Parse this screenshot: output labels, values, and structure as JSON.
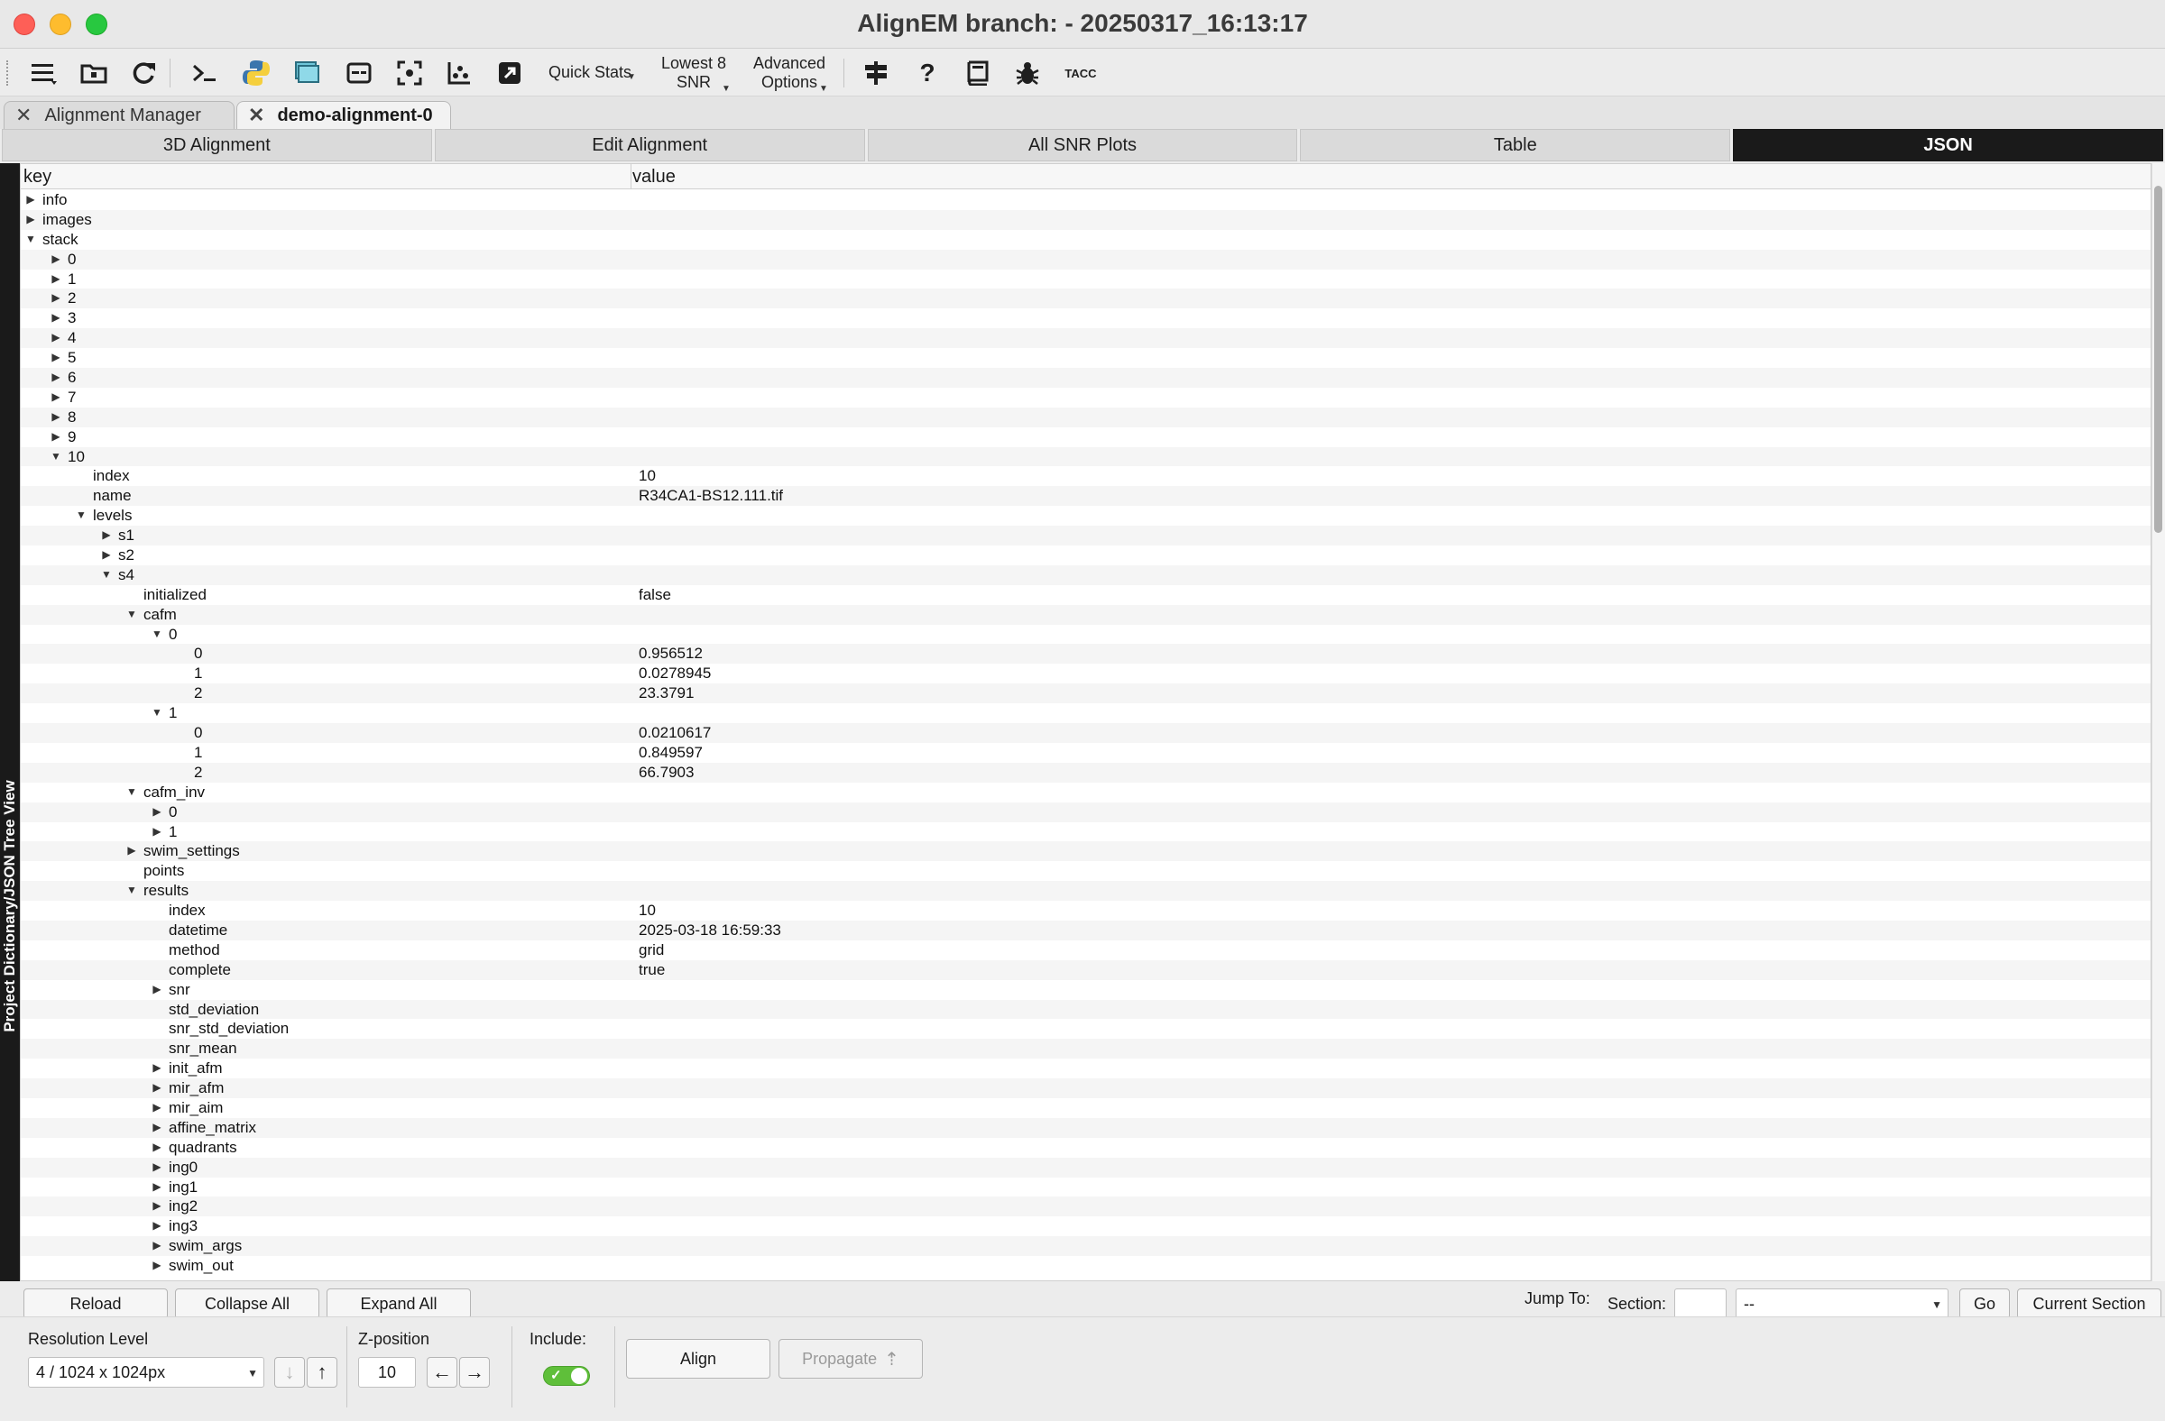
{
  "window": {
    "title": "AlignEM branch:  - 20250317_16:13:17"
  },
  "toolbar": {
    "quick_stats": "Quick Stats",
    "lowest_line1": "Lowest 8",
    "lowest_line2": "SNR",
    "advanced_line1": "Advanced",
    "advanced_line2": "Options",
    "tacc_label": "TACC",
    "help_label": "?"
  },
  "doc_tabs": [
    {
      "label": "Alignment Manager",
      "active": false
    },
    {
      "label": "demo-alignment-0",
      "active": true
    }
  ],
  "view_tabs": [
    "3D Alignment",
    "Edit Alignment",
    "All SNR Plots",
    "Table",
    "JSON"
  ],
  "active_view_tab": "JSON",
  "side_label": "Project Dictionary/JSON Tree View",
  "tree": {
    "header_key": "key",
    "header_value": "value",
    "rows": [
      {
        "depth": 0,
        "state": "collapsed",
        "key": "info",
        "value": ""
      },
      {
        "depth": 0,
        "state": "collapsed",
        "key": "images",
        "value": ""
      },
      {
        "depth": 0,
        "state": "expanded",
        "key": "stack",
        "value": ""
      },
      {
        "depth": 1,
        "state": "collapsed",
        "key": "0",
        "value": ""
      },
      {
        "depth": 1,
        "state": "collapsed",
        "key": "1",
        "value": ""
      },
      {
        "depth": 1,
        "state": "collapsed",
        "key": "2",
        "value": ""
      },
      {
        "depth": 1,
        "state": "collapsed",
        "key": "3",
        "value": ""
      },
      {
        "depth": 1,
        "state": "collapsed",
        "key": "4",
        "value": ""
      },
      {
        "depth": 1,
        "state": "collapsed",
        "key": "5",
        "value": ""
      },
      {
        "depth": 1,
        "state": "collapsed",
        "key": "6",
        "value": ""
      },
      {
        "depth": 1,
        "state": "collapsed",
        "key": "7",
        "value": ""
      },
      {
        "depth": 1,
        "state": "collapsed",
        "key": "8",
        "value": ""
      },
      {
        "depth": 1,
        "state": "collapsed",
        "key": "9",
        "value": ""
      },
      {
        "depth": 1,
        "state": "expanded",
        "key": "10",
        "value": ""
      },
      {
        "depth": 2,
        "state": "leaf",
        "key": "index",
        "value": "10"
      },
      {
        "depth": 2,
        "state": "leaf",
        "key": "name",
        "value": "R34CA1-BS12.111.tif"
      },
      {
        "depth": 2,
        "state": "expanded",
        "key": "levels",
        "value": ""
      },
      {
        "depth": 3,
        "state": "collapsed",
        "key": "s1",
        "value": ""
      },
      {
        "depth": 3,
        "state": "collapsed",
        "key": "s2",
        "value": ""
      },
      {
        "depth": 3,
        "state": "expanded",
        "key": "s4",
        "value": ""
      },
      {
        "depth": 4,
        "state": "leaf",
        "key": "initialized",
        "value": "false"
      },
      {
        "depth": 4,
        "state": "expanded",
        "key": "cafm",
        "value": ""
      },
      {
        "depth": 5,
        "state": "expanded",
        "key": "0",
        "value": ""
      },
      {
        "depth": 6,
        "state": "leaf",
        "key": "0",
        "value": "0.956512"
      },
      {
        "depth": 6,
        "state": "leaf",
        "key": "1",
        "value": "0.0278945"
      },
      {
        "depth": 6,
        "state": "leaf",
        "key": "2",
        "value": "23.3791"
      },
      {
        "depth": 5,
        "state": "expanded",
        "key": "1",
        "value": ""
      },
      {
        "depth": 6,
        "state": "leaf",
        "key": "0",
        "value": "0.0210617"
      },
      {
        "depth": 6,
        "state": "leaf",
        "key": "1",
        "value": "0.849597"
      },
      {
        "depth": 6,
        "state": "leaf",
        "key": "2",
        "value": "66.7903"
      },
      {
        "depth": 4,
        "state": "expanded",
        "key": "cafm_inv",
        "value": ""
      },
      {
        "depth": 5,
        "state": "collapsed",
        "key": "0",
        "value": ""
      },
      {
        "depth": 5,
        "state": "collapsed",
        "key": "1",
        "value": ""
      },
      {
        "depth": 4,
        "state": "collapsed",
        "key": "swim_settings",
        "value": ""
      },
      {
        "depth": 4,
        "state": "leaf",
        "key": "points",
        "value": ""
      },
      {
        "depth": 4,
        "state": "expanded",
        "key": "results",
        "value": ""
      },
      {
        "depth": 5,
        "state": "leaf",
        "key": "index",
        "value": "10"
      },
      {
        "depth": 5,
        "state": "leaf",
        "key": "datetime",
        "value": "2025-03-18 16:59:33"
      },
      {
        "depth": 5,
        "state": "leaf",
        "key": "method",
        "value": "grid"
      },
      {
        "depth": 5,
        "state": "leaf",
        "key": "complete",
        "value": "true"
      },
      {
        "depth": 5,
        "state": "collapsed",
        "key": "snr",
        "value": ""
      },
      {
        "depth": 5,
        "state": "leaf",
        "key": "std_deviation",
        "value": ""
      },
      {
        "depth": 5,
        "state": "leaf",
        "key": "snr_std_deviation",
        "value": ""
      },
      {
        "depth": 5,
        "state": "leaf",
        "key": "snr_mean",
        "value": ""
      },
      {
        "depth": 5,
        "state": "collapsed",
        "key": "init_afm",
        "value": ""
      },
      {
        "depth": 5,
        "state": "collapsed",
        "key": "mir_afm",
        "value": ""
      },
      {
        "depth": 5,
        "state": "collapsed",
        "key": "mir_aim",
        "value": ""
      },
      {
        "depth": 5,
        "state": "collapsed",
        "key": "affine_matrix",
        "value": ""
      },
      {
        "depth": 5,
        "state": "collapsed",
        "key": "quadrants",
        "value": ""
      },
      {
        "depth": 5,
        "state": "collapsed",
        "key": "ing0",
        "value": ""
      },
      {
        "depth": 5,
        "state": "collapsed",
        "key": "ing1",
        "value": ""
      },
      {
        "depth": 5,
        "state": "collapsed",
        "key": "ing2",
        "value": ""
      },
      {
        "depth": 5,
        "state": "collapsed",
        "key": "ing3",
        "value": ""
      },
      {
        "depth": 5,
        "state": "collapsed",
        "key": "swim_args",
        "value": ""
      },
      {
        "depth": 5,
        "state": "collapsed",
        "key": "swim_out",
        "value": ""
      }
    ]
  },
  "tree_buttons": {
    "reload": "Reload",
    "collapse_all": "Collapse All",
    "expand_all": "Expand All"
  },
  "jump": {
    "label": "Jump To:",
    "section_label": "Section:",
    "section_value": "",
    "combo_value": "--",
    "go": "Go",
    "current_section": "Current Section"
  },
  "controls": {
    "resolution_label": "Resolution Level",
    "resolution_value": "4 / 1024 x 1024px",
    "zpos_label": "Z-position",
    "zpos_value": "10",
    "include_label": "Include:",
    "include_on": true,
    "align": "Align",
    "propagate": "Propagate"
  },
  "colors": {
    "active_tab": "#1a1a1a",
    "toggle_on": "#5fbf3a"
  }
}
